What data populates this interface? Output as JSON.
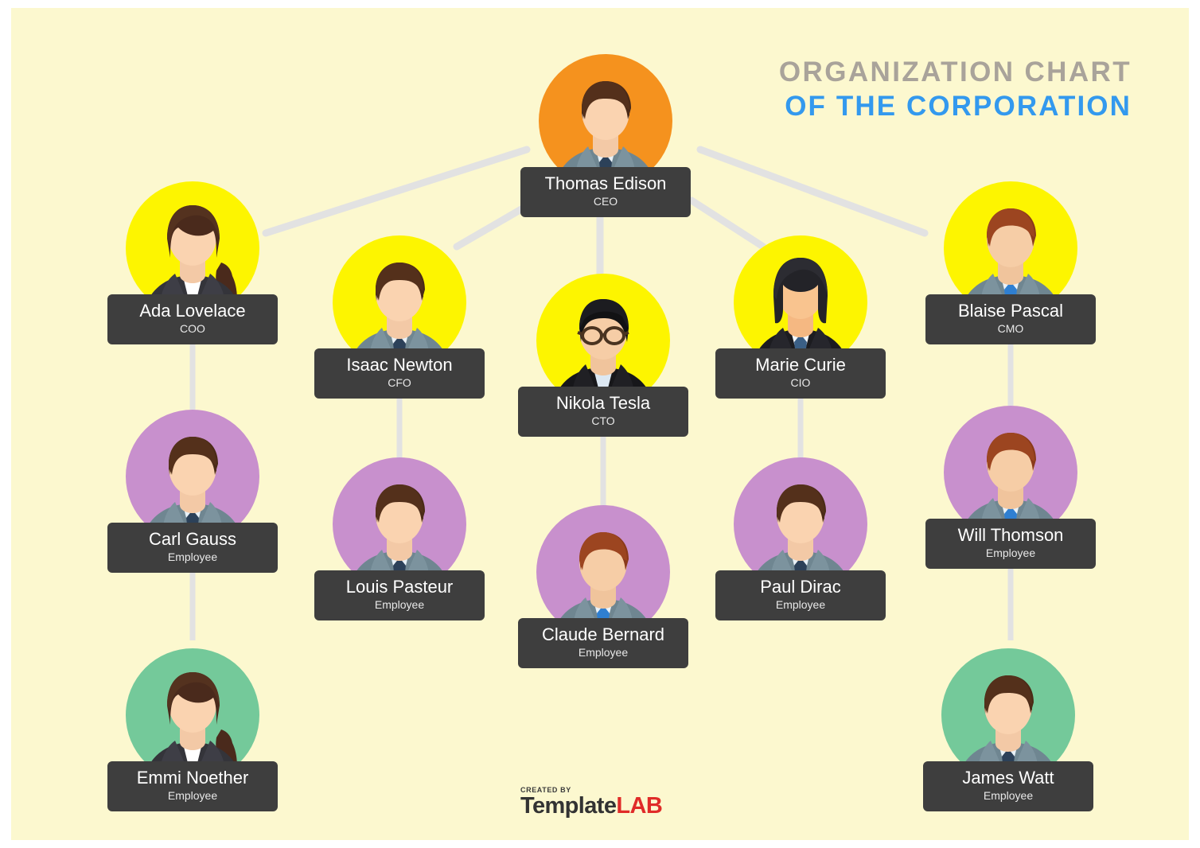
{
  "page": {
    "background_color": "#fcf8cf",
    "connector_color": "#e2e2e2",
    "label_box_color": "#3e3e3e"
  },
  "header": {
    "title_line1": "ORGANIZATION CHART",
    "title_line2": "OF THE CORPORATION",
    "title_line1_color": "#a9a39a",
    "title_line2_color": "#3399ee"
  },
  "footer": {
    "created_by": "CREATED BY",
    "brand_first": "Template",
    "brand_second": "LAB",
    "brand_first_color": "#333333",
    "brand_second_color": "#e02b28"
  },
  "chart_data": {
    "type": "org-chart",
    "title": "ORGANIZATION CHART OF THE CORPORATION",
    "levels": 4,
    "nodes": [
      {
        "id": "ceo",
        "name": "Thomas Edison",
        "role": "CEO",
        "level": 1,
        "halo_color": "#f5921e",
        "avatar": "male-short-dark-hair-gray-suit-navy-tie",
        "parent": null
      },
      {
        "id": "coo",
        "name": "Ada Lovelace",
        "role": "COO",
        "level": 2,
        "halo_color": "#fdf500",
        "avatar": "female-ponytail-dark-blazer",
        "parent": "ceo"
      },
      {
        "id": "cfo",
        "name": "Isaac Newton",
        "role": "CFO",
        "level": 2,
        "halo_color": "#fdf500",
        "avatar": "male-brown-hair-gray-suit-navy-tie",
        "parent": "ceo"
      },
      {
        "id": "cto",
        "name": "Nikola Tesla",
        "role": "CTO",
        "level": 2,
        "halo_color": "#fdf500",
        "avatar": "male-black-hair-glasses-black-jacket",
        "parent": "ceo"
      },
      {
        "id": "cio",
        "name": "Marie Curie",
        "role": "CIO",
        "level": 2,
        "halo_color": "#fdf500",
        "avatar": "female-black-bob-black-suit-navy-tie",
        "parent": "ceo"
      },
      {
        "id": "cmo",
        "name": "Blaise Pascal",
        "role": "CMO",
        "level": 2,
        "halo_color": "#fdf500",
        "avatar": "male-auburn-hair-gray-suit-blue-tie",
        "parent": "ceo"
      },
      {
        "id": "emp-gauss",
        "name": "Carl Gauss",
        "role": "Employee",
        "level": 3,
        "halo_color": "#c890cd",
        "avatar": "male-dark-brown-hair-gray-suit-navy-tie",
        "parent": "coo"
      },
      {
        "id": "emp-pasteur",
        "name": "Louis Pasteur",
        "role": "Employee",
        "level": 3,
        "halo_color": "#c890cd",
        "avatar": "male-dark-brown-hair-gray-suit-navy-tie",
        "parent": "cfo"
      },
      {
        "id": "emp-bernard",
        "name": "Claude Bernard",
        "role": "Employee",
        "level": 3,
        "halo_color": "#c890cd",
        "avatar": "male-auburn-hair-gray-suit-blue-tie",
        "parent": "cto"
      },
      {
        "id": "emp-dirac",
        "name": "Paul Dirac",
        "role": "Employee",
        "level": 3,
        "halo_color": "#c890cd",
        "avatar": "male-dark-brown-hair-gray-suit-navy-tie",
        "parent": "cio"
      },
      {
        "id": "emp-thomson",
        "name": "Will Thomson",
        "role": "Employee",
        "level": 3,
        "halo_color": "#c890cd",
        "avatar": "male-auburn-hair-gray-suit-blue-tie",
        "parent": "cmo"
      },
      {
        "id": "emp-noether",
        "name": "Emmi Noether",
        "role": "Employee",
        "level": 4,
        "halo_color": "#74c99a",
        "avatar": "female-ponytail-dark-blazer",
        "parent": "emp-gauss"
      },
      {
        "id": "emp-watt",
        "name": "James Watt",
        "role": "Employee",
        "level": 4,
        "halo_color": "#74c99a",
        "avatar": "male-dark-brown-hair-gray-suit-navy-tie",
        "parent": "emp-thomson"
      }
    ]
  }
}
